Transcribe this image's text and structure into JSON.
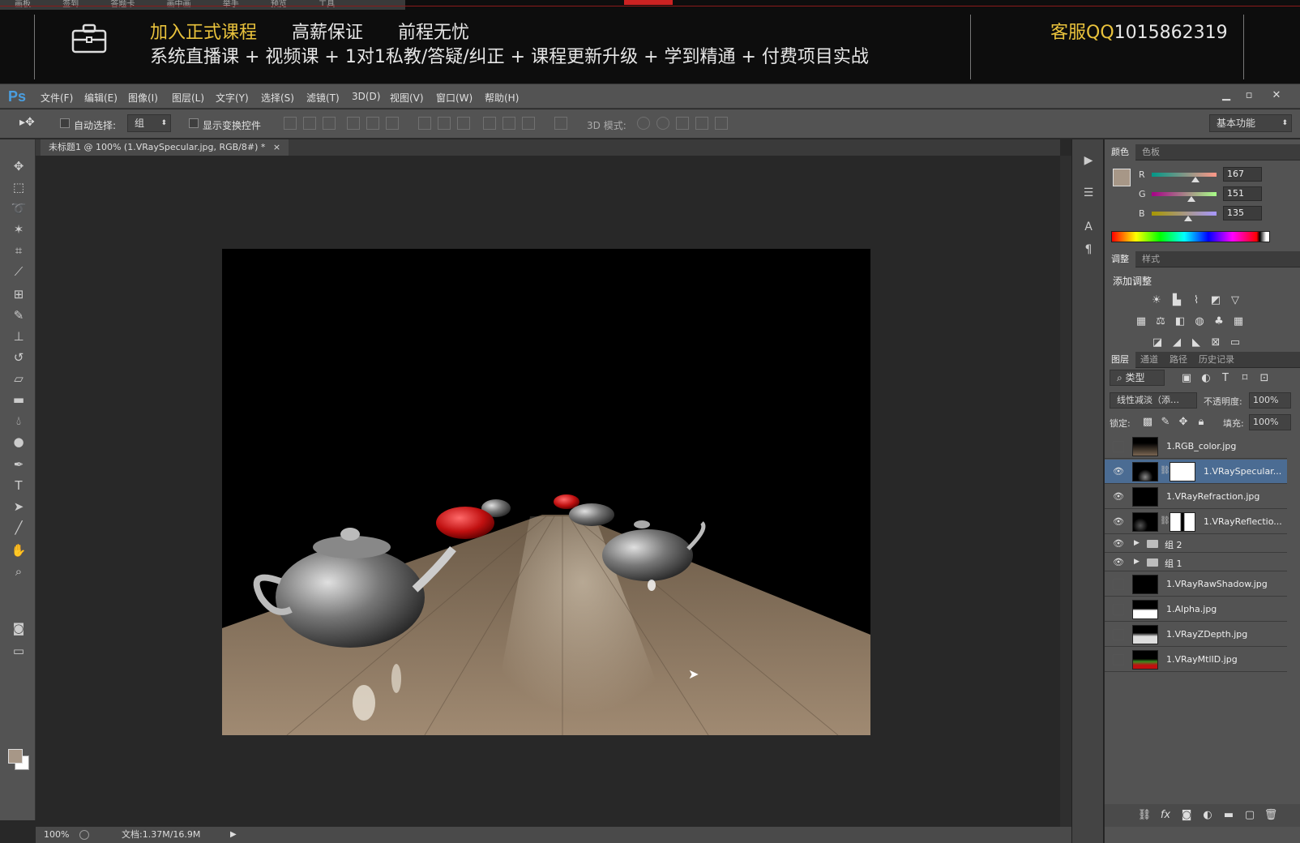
{
  "banner": {
    "top_strip": [
      "画板",
      "签到",
      "答题卡",
      "画中画",
      "举手",
      "预览",
      "工具"
    ],
    "line1_highlight": "加入正式课程",
    "line1_items": [
      "高薪保证",
      "前程无忧"
    ],
    "line2": "系统直播课 + 视频课 + 1对1私教/答疑/纠正 + 课程更新升级 + 学到精通 + 付费项目实战",
    "qq_label": "客服QQ",
    "qq_number": "1015862319"
  },
  "app": {
    "logo": "Ps",
    "menu": [
      "文件(F)",
      "编辑(E)",
      "图像(I)",
      "图层(L)",
      "文字(Y)",
      "选择(S)",
      "滤镜(T)",
      "3D(D)",
      "视图(V)",
      "窗口(W)",
      "帮助(H)"
    ],
    "window_controls": [
      "▁",
      "▫",
      "✕"
    ]
  },
  "options": {
    "auto_select_label": "自动选择:",
    "auto_select_value": "组",
    "show_transform_label": "显示变换控件",
    "mode_3d_label": "3D 模式:",
    "workspace": "基本功能"
  },
  "document": {
    "tab_title": "未标题1 @ 100% (1.VRaySpecular.jpg, RGB/8#) *",
    "zoom": "100%",
    "doc_size": "文档:1.37M/16.9M"
  },
  "color_panel": {
    "tabs": [
      "颜色",
      "色板"
    ],
    "r_label": "R",
    "r": "167",
    "g_label": "G",
    "g": "151",
    "b_label": "B",
    "b": "135",
    "swatch_color": "#a79787"
  },
  "adjust_panel": {
    "tabs": [
      "调整",
      "样式"
    ],
    "title": "添加调整"
  },
  "layers_panel": {
    "tabs": [
      "图层",
      "通道",
      "路径",
      "历史记录"
    ],
    "filter": "类型",
    "blend_mode": "线性减淡（添…",
    "opacity_label": "不透明度:",
    "opacity": "100%",
    "lock_label": "锁定:",
    "fill_label": "填充:",
    "fill": "100%",
    "layers": [
      {
        "name": "1.RGB_color.jpg",
        "visible": false,
        "mask": false
      },
      {
        "name": "1.VRaySpecular...",
        "visible": true,
        "mask": true,
        "selected": true
      },
      {
        "name": "1.VRayRefraction.jpg",
        "visible": true,
        "mask": false
      },
      {
        "name": "1.VRayReflectio...",
        "visible": true,
        "mask": true
      },
      {
        "name": "组 2",
        "visible": true,
        "group": true
      },
      {
        "name": "组 1",
        "visible": true,
        "group": true
      },
      {
        "name": "1.VRayRawShadow.jpg",
        "visible": false,
        "mask": false
      },
      {
        "name": "1.Alpha.jpg",
        "visible": false,
        "mask": false
      },
      {
        "name": "1.VRayZDepth.jpg",
        "visible": false,
        "mask": false
      },
      {
        "name": "1.VRayMtlID.jpg",
        "visible": false,
        "mask": false
      }
    ]
  },
  "colors": {
    "banner_highlight": "#e9c23c",
    "ps_blue": "#4a9ee0",
    "selected_layer": "#4b6c93"
  }
}
